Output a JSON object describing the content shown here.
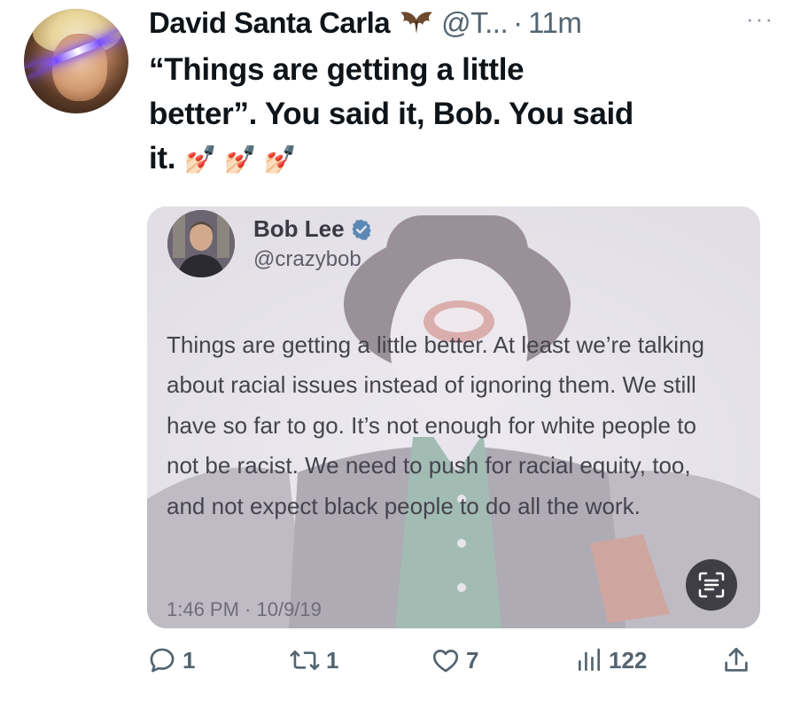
{
  "tweet": {
    "author_name": "David Santa Carla",
    "author_emoji_icon": "bat-icon",
    "handle": "@T...",
    "separator": "·",
    "time": "11m",
    "more_icon": "more-icon",
    "text_line1": "“Things are getting a little",
    "text_line2": "better”. You said it, Bob. You said",
    "text_line3": "it.",
    "nail_emoji": "💅🏻 💅🏻 💅🏻"
  },
  "quoted": {
    "author_name": "Bob Lee",
    "verified_icon": "verified-icon",
    "handle": "@crazybob",
    "text": "Things are getting a little better. At least we’re talking about racial issues instead of ignoring them. We still have so far to go. It’s not enough for white people to not be racist. We need to push for racial equity, too, and not expect black people to do all the work.",
    "time": "1:46 PM · 10/9/19",
    "scan_icon": "text-scan-icon"
  },
  "actions": {
    "replies": "1",
    "retweets": "1",
    "likes": "7",
    "views": "122"
  },
  "colors": {
    "text": "#0f1419",
    "muted": "#536471",
    "verified": "#1d9bf0",
    "quote_text": "#45434d"
  }
}
